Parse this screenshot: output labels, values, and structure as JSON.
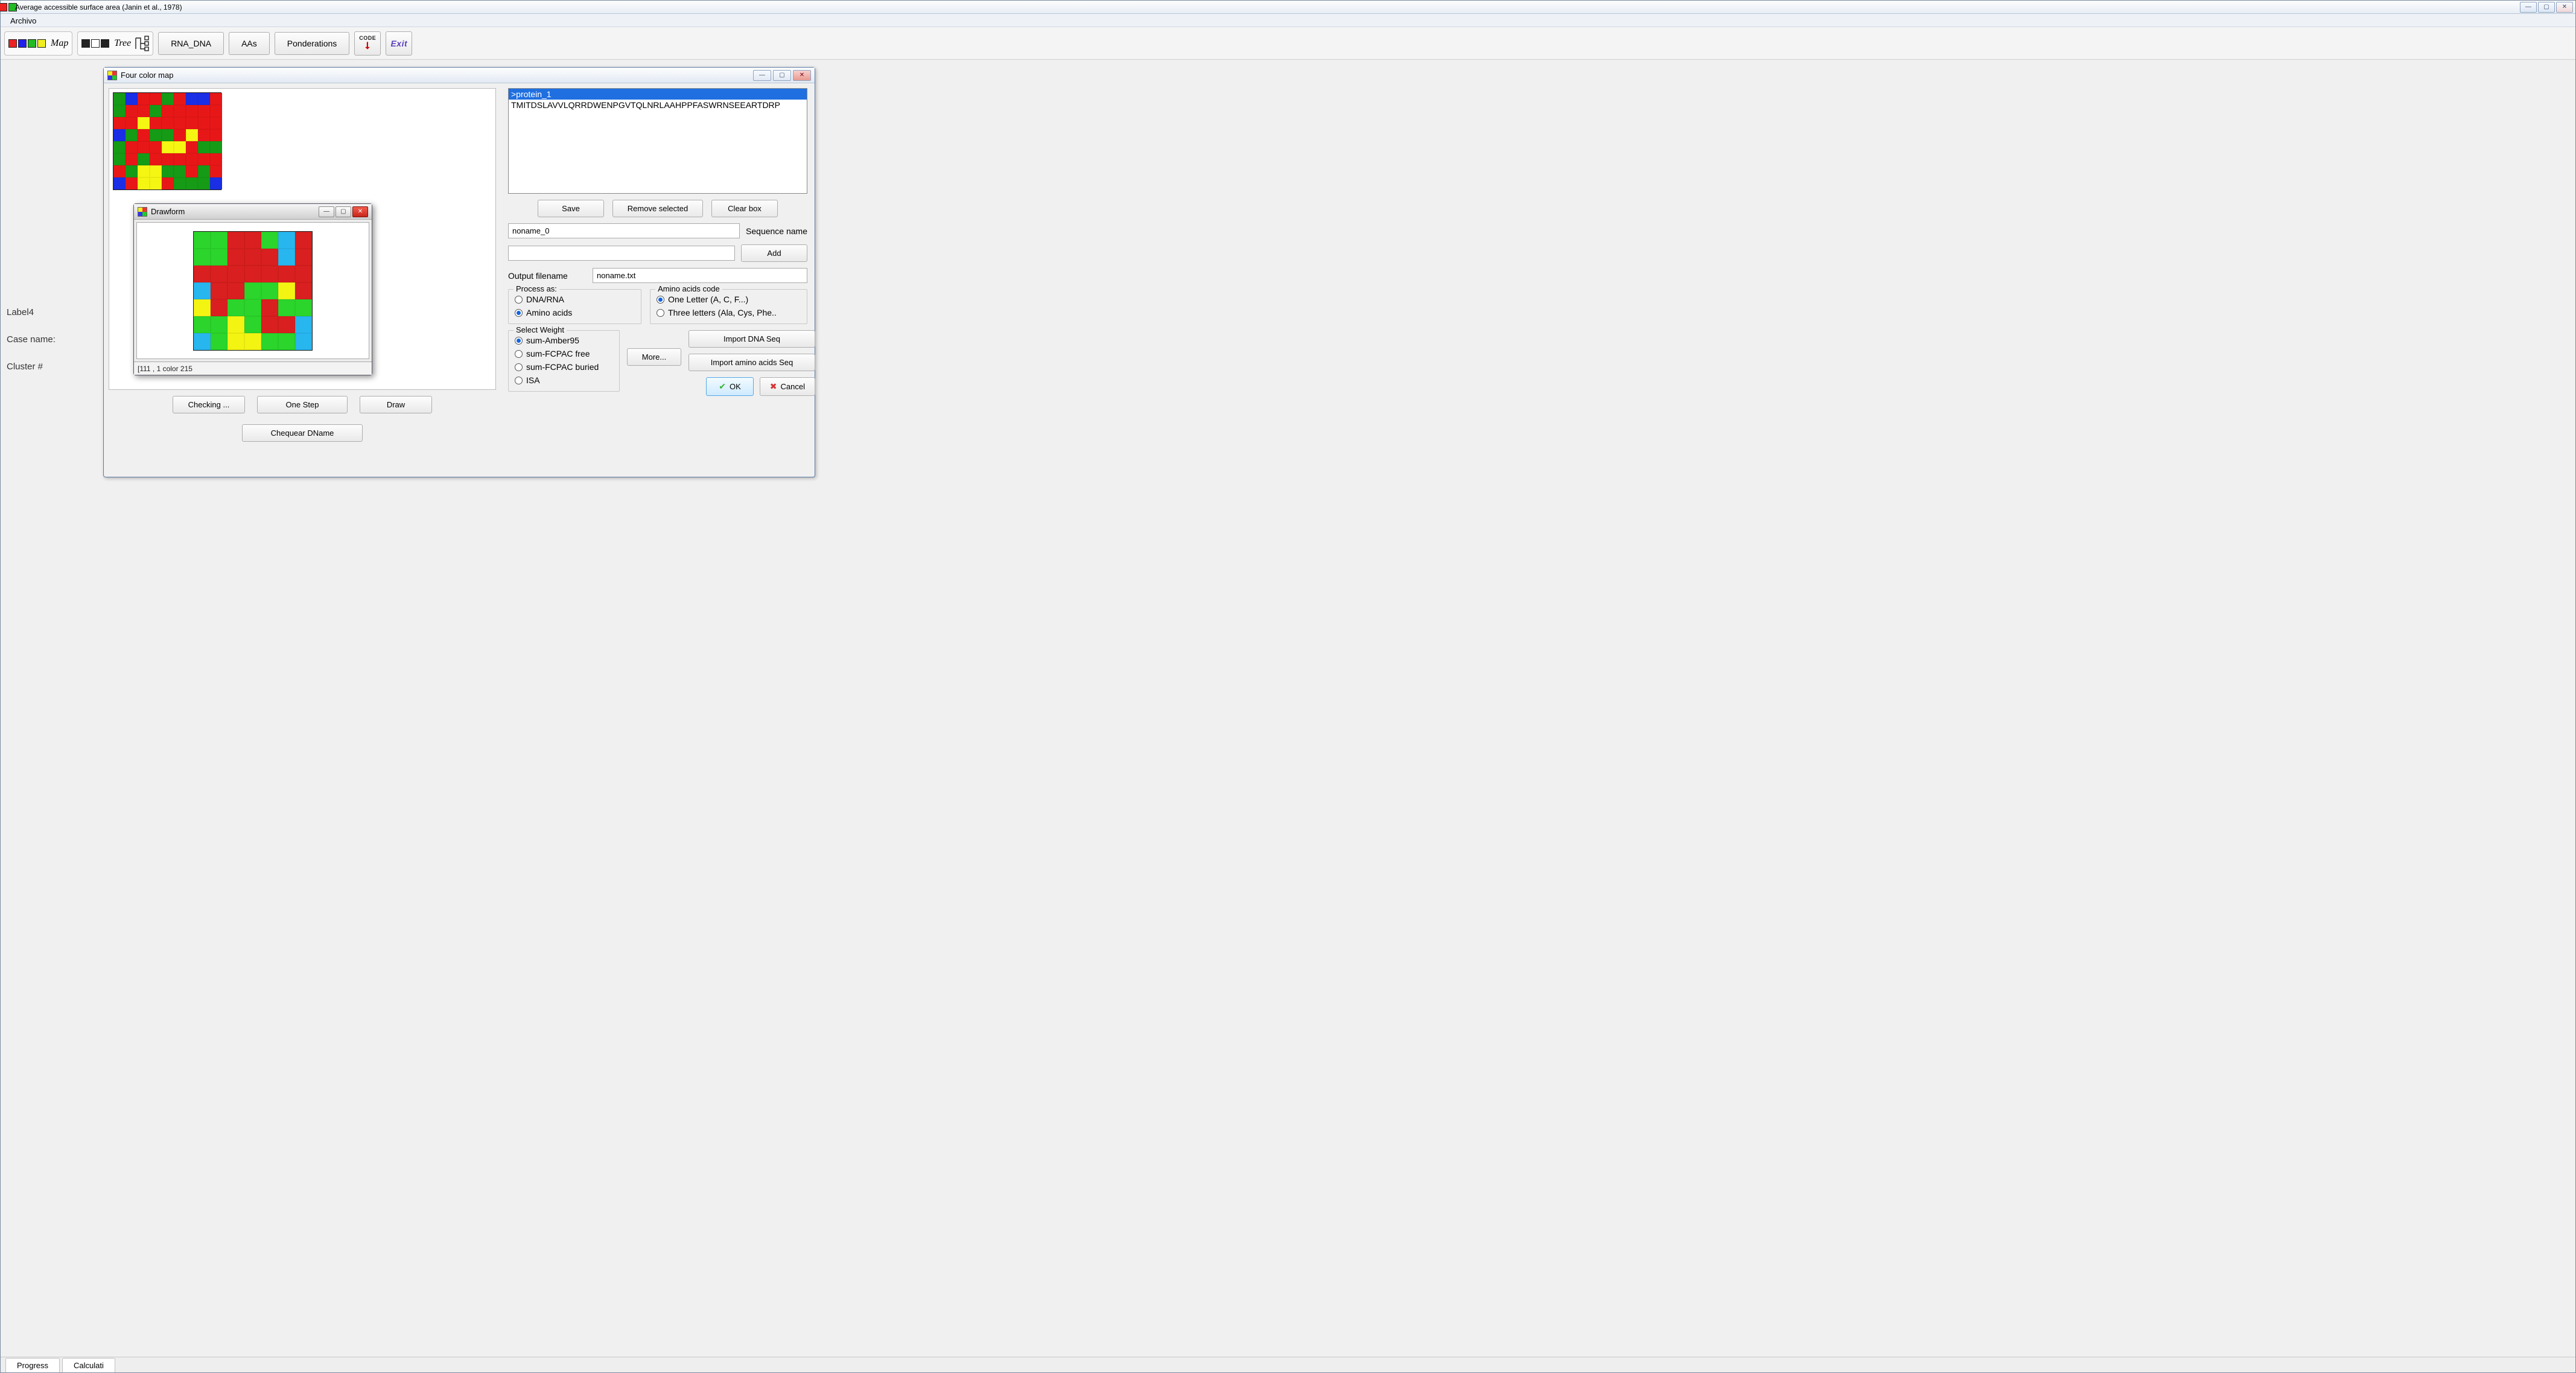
{
  "window": {
    "title": "Average accessible surface area (Janin et al., 1978)",
    "min": "—",
    "max": "▢",
    "close": "✕"
  },
  "menubar": {
    "archivo": "Archivo"
  },
  "toolbar": {
    "map_label": "Map",
    "tree_label": "Tree",
    "rna_dna": "RNA_DNA",
    "aas": "AAs",
    "ponderations": "Ponderations",
    "code_label": "CODE",
    "exit_label": "Exit"
  },
  "side": {
    "label4": "Label4",
    "casename": "Case name:",
    "cluster": "Cluster #"
  },
  "fcm": {
    "title": "Four color map",
    "min": "—",
    "max": "▢",
    "close": "✕",
    "grid": [
      [
        "g",
        "b",
        "r",
        "r",
        "g",
        "r",
        "b",
        "b",
        "r"
      ],
      [
        "g",
        "r",
        "r",
        "g",
        "r",
        "r",
        "r",
        "r",
        "r"
      ],
      [
        "r",
        "r",
        "y",
        "r",
        "r",
        "r",
        "r",
        "r",
        "r"
      ],
      [
        "b",
        "g",
        "r",
        "g",
        "g",
        "r",
        "y",
        "r",
        "r"
      ],
      [
        "g",
        "r",
        "r",
        "r",
        "y",
        "y",
        "r",
        "g",
        "g"
      ],
      [
        "g",
        "r",
        "g",
        "r",
        "r",
        "r",
        "r",
        "r",
        "r"
      ],
      [
        "r",
        "g",
        "y",
        "y",
        "g",
        "g",
        "r",
        "g",
        "r"
      ],
      [
        "b",
        "r",
        "y",
        "y",
        "r",
        "g",
        "g",
        "g",
        "b"
      ]
    ],
    "buttons": {
      "checking": "Checking ...",
      "onestep": "One Step",
      "draw": "Draw",
      "chequear": "Chequear DName"
    }
  },
  "drawform": {
    "title": "Drawform",
    "status": "[111 , 1 color 215",
    "min": "—",
    "max": "▢",
    "close": "✕",
    "grid": [
      [
        "lg",
        "lg",
        "rd",
        "rd",
        "lg",
        "lb",
        "rd"
      ],
      [
        "lg",
        "lg",
        "rd",
        "rd",
        "rd",
        "lb",
        "rd"
      ],
      [
        "rd",
        "rd",
        "rd",
        "rd",
        "rd",
        "rd",
        "rd"
      ],
      [
        "lb",
        "rd",
        "rd",
        "lg",
        "lg",
        "ye",
        "rd"
      ],
      [
        "ye",
        "rd",
        "lg",
        "lg",
        "rd",
        "lg",
        "lg"
      ],
      [
        "lg",
        "lg",
        "ye",
        "lg",
        "rd",
        "rd",
        "lb"
      ],
      [
        "lb",
        "lg",
        "ye",
        "ye",
        "lg",
        "lg",
        "lb"
      ]
    ]
  },
  "right": {
    "seq_header": ">protein_1",
    "seq_body": "TMITDSLAVVLQRRDWENPGVTQLNRLAAHPPFASWRNSEEARTDRP",
    "save": "Save",
    "remove": "Remove selected",
    "clear": "Clear box",
    "seqname_value": "noname_0",
    "seqname_label": "Sequence name",
    "add": "Add",
    "add_value": "",
    "out_label": "Output filename",
    "out_value": "noname.txt",
    "process_legend": "Process as:",
    "process_dna": "DNA/RNA",
    "process_aa": "Amino acids",
    "aac_legend": "Amino acids code",
    "aac_one": "One Letter (A, C, F...)",
    "aac_three": "Three letters (Ala, Cys, Phe..",
    "weight_legend": "Select Weight",
    "w_amber": "sum-Amber95",
    "w_fcpac_free": "sum-FCPAC free",
    "w_fcpac_buried": "sum-FCPAC buried",
    "w_isa": "ISA",
    "more": "More...",
    "import_dna": "Import DNA Seq",
    "import_aa": "Import amino acids Seq",
    "ok": "OK",
    "cancel": "Cancel"
  },
  "bottom": {
    "progress": "Progress",
    "calc": "Calculati"
  }
}
